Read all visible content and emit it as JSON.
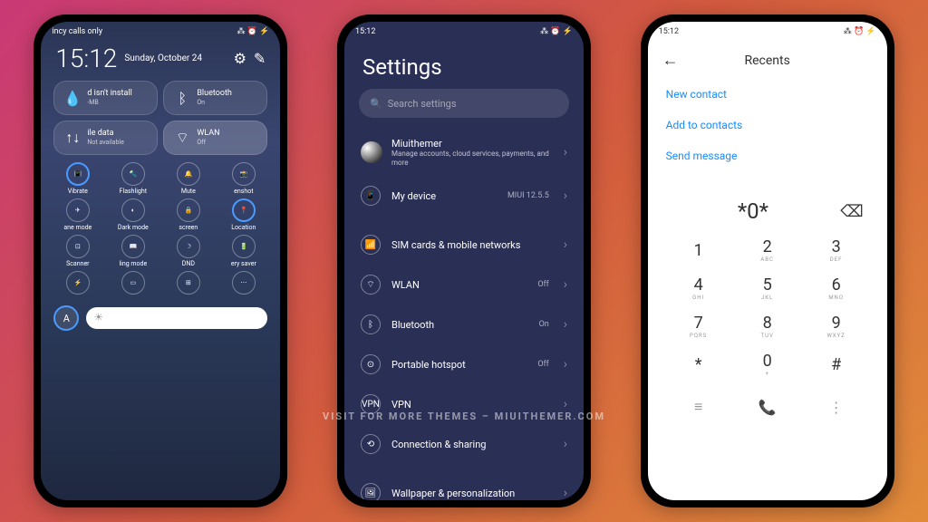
{
  "status": {
    "carrier": "incy calls only",
    "time": "15:12",
    "icons": "⁂ ⏰ ⚡"
  },
  "cc": {
    "time": "15:12",
    "date": "Sunday, October 24",
    "tiles": [
      {
        "label": "d isn't install",
        "sub": "-MB",
        "icon": "💧"
      },
      {
        "label": "Bluetooth",
        "sub": "On",
        "icon": "ᛒ"
      },
      {
        "label": "ile data",
        "sub": "Not available",
        "icon": "↑↓"
      },
      {
        "label": "WLAN",
        "sub": "Off",
        "icon": "⌔"
      }
    ],
    "quick1": [
      {
        "label": "Vibrate",
        "icon": "📳"
      },
      {
        "label": "Flashlight",
        "icon": "🔦"
      },
      {
        "label": "Mute",
        "icon": "🔔"
      },
      {
        "label": "enshot",
        "icon": "📸"
      }
    ],
    "quick2": [
      {
        "label": "ane mode",
        "icon": "✈"
      },
      {
        "label": "Dark mode",
        "icon": "◐"
      },
      {
        "label": "screen",
        "icon": "🔒"
      },
      {
        "label": "Location",
        "icon": "📍"
      }
    ],
    "quick3": [
      {
        "label": "Scanner",
        "icon": "⊡"
      },
      {
        "label": "ling mode",
        "icon": "📖"
      },
      {
        "label": "DND",
        "icon": "☽"
      },
      {
        "label": "ery saver",
        "icon": "🔋"
      }
    ],
    "quick4": [
      {
        "label": "",
        "icon": "⚡"
      },
      {
        "label": "",
        "icon": "▭"
      },
      {
        "label": "",
        "icon": "⊞"
      },
      {
        "label": "",
        "icon": "⋯"
      }
    ],
    "auto": "A"
  },
  "settings": {
    "title": "Settings",
    "search": "Search settings",
    "profile": {
      "name": "Miuithemer",
      "sub": "Manage accounts, cloud services, payments, and more"
    },
    "rows": [
      {
        "icon": "📱",
        "label": "My device",
        "val": "MIUI 12.5.5"
      },
      {
        "gap": true
      },
      {
        "icon": "📶",
        "label": "SIM cards & mobile networks",
        "val": ""
      },
      {
        "icon": "⌔",
        "label": "WLAN",
        "val": "Off"
      },
      {
        "icon": "ᛒ",
        "label": "Bluetooth",
        "val": "On"
      },
      {
        "icon": "⊙",
        "label": "Portable hotspot",
        "val": "Off"
      },
      {
        "icon": "VPN",
        "label": "VPN",
        "val": ""
      },
      {
        "icon": "⟲",
        "label": "Connection & sharing",
        "val": ""
      },
      {
        "gap": true
      },
      {
        "icon": "🖼",
        "label": "Wallpaper & personalization",
        "val": ""
      }
    ]
  },
  "dialer": {
    "title": "Recents",
    "links": [
      "New contact",
      "Add to contacts",
      "Send message"
    ],
    "number": "*0*",
    "keys": [
      {
        "n": "1",
        "s": ""
      },
      {
        "n": "2",
        "s": "ABC"
      },
      {
        "n": "3",
        "s": "DEF"
      },
      {
        "n": "4",
        "s": "GHI"
      },
      {
        "n": "5",
        "s": "JKL"
      },
      {
        "n": "6",
        "s": "MNO"
      },
      {
        "n": "7",
        "s": "PQRS"
      },
      {
        "n": "8",
        "s": "TUV"
      },
      {
        "n": "9",
        "s": "WXYZ"
      },
      {
        "n": "*",
        "s": ""
      },
      {
        "n": "0",
        "s": "+"
      },
      {
        "n": "#",
        "s": ""
      }
    ]
  },
  "watermark": "Visit for more themes – miuithemer.com"
}
